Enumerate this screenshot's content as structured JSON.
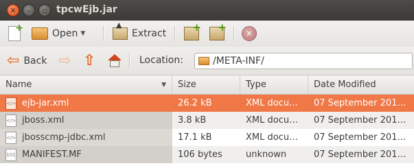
{
  "window": {
    "title": "tpcwEjb.jar"
  },
  "toolbar": {
    "open_label": "Open",
    "extract_label": "Extract"
  },
  "location_bar": {
    "back_label": "Back",
    "location_label": "Location:",
    "location_value": "/META-INF/"
  },
  "table": {
    "columns": [
      "Name",
      "Size",
      "Type",
      "Date Modified"
    ],
    "rows": [
      {
        "name": "ejb-jar.xml",
        "size": "26.2 kB",
        "type": "XML docu…",
        "date": "07 September 201…",
        "icon": "xml-file-icon",
        "selected": true
      },
      {
        "name": "jboss.xml",
        "size": "3.8 kB",
        "type": "XML docu…",
        "date": "07 September 201…",
        "icon": "xml-file-icon",
        "selected": false
      },
      {
        "name": "jbosscmp-jdbc.xml",
        "size": "17.1 kB",
        "type": "XML docu…",
        "date": "07 September 201…",
        "icon": "xml-file-icon",
        "selected": false
      },
      {
        "name": "MANIFEST.MF",
        "size": "106 bytes",
        "type": "unknown",
        "date": "07 September 201…",
        "icon": "binary-file-icon",
        "selected": false
      }
    ]
  },
  "colors": {
    "accent": "#f07746",
    "titlebar": "#3c3b37"
  }
}
